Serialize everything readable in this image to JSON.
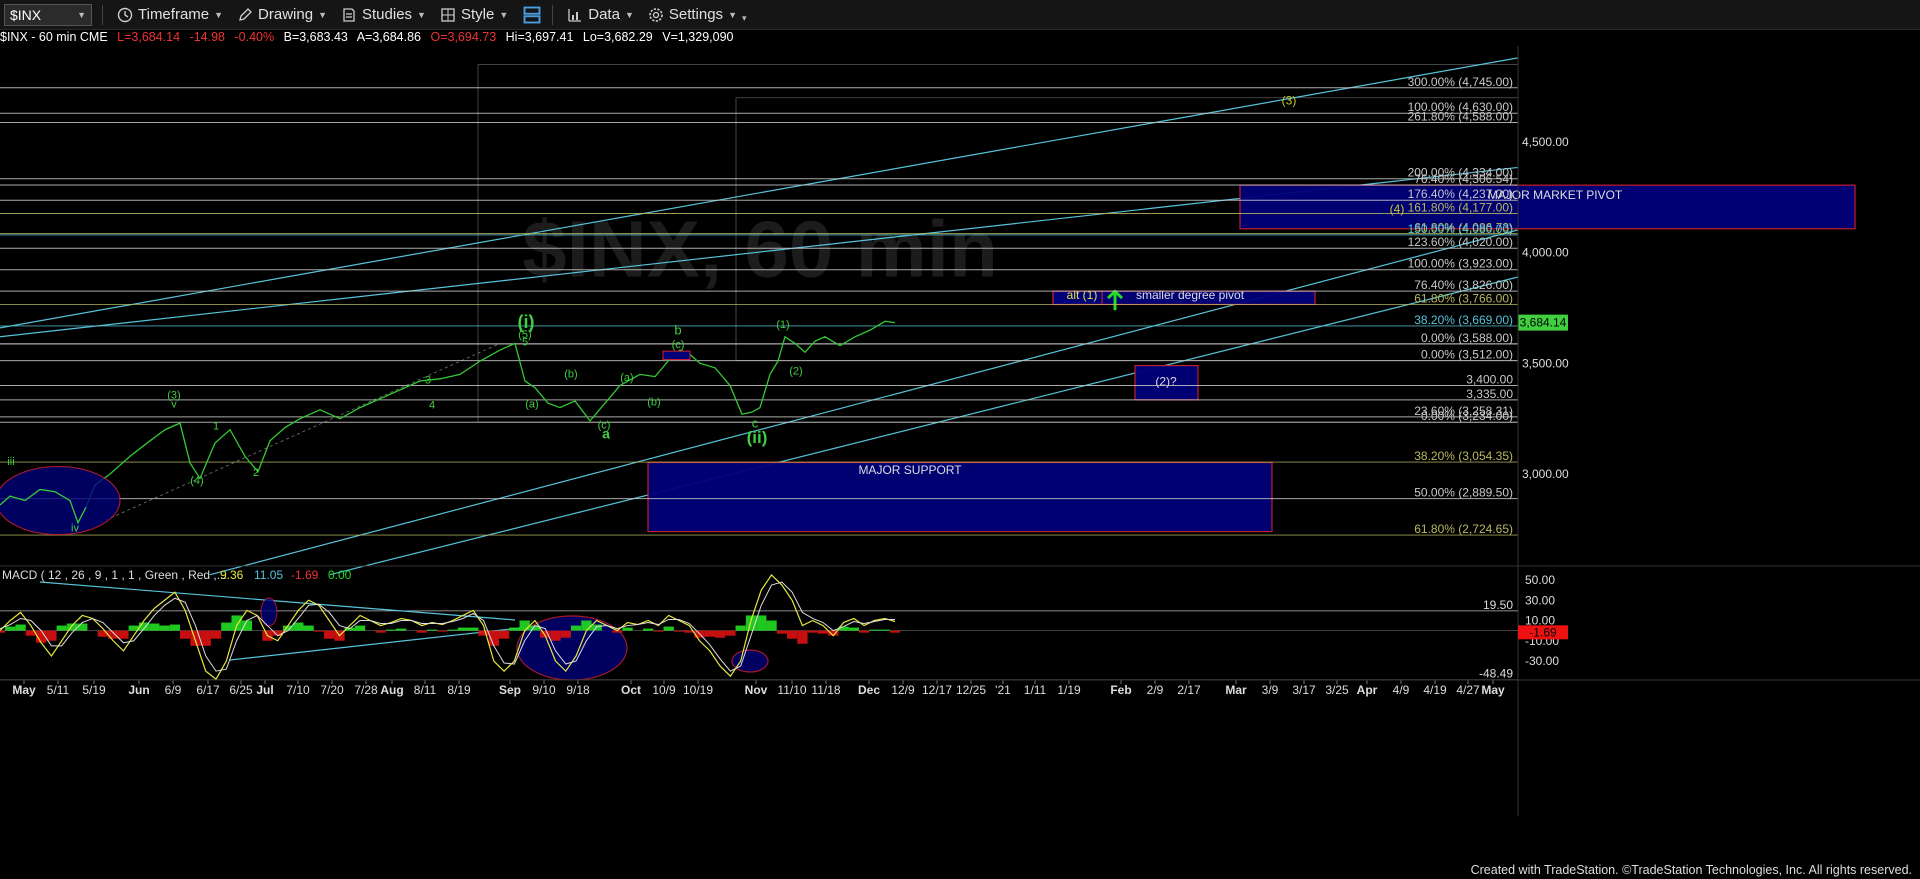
{
  "toolbar": {
    "symbol": "$INX",
    "items": [
      {
        "label": "Timeframe",
        "icon": "clock-icon"
      },
      {
        "label": "Drawing",
        "icon": "pencil-icon"
      },
      {
        "label": "Studies",
        "icon": "studies-icon"
      },
      {
        "label": "Style",
        "icon": "style-icon"
      },
      {
        "label": "",
        "icon": "layout-icon"
      },
      {
        "label": "Data",
        "icon": "data-icon"
      },
      {
        "label": "Settings",
        "icon": "gear-icon"
      }
    ]
  },
  "infobar": {
    "title": "$INX - 60 min  CME",
    "L": "L=3,684.14",
    "chg": "-14.98",
    "pct": "-0.40%",
    "B": "B=3,683.43",
    "A": "A=3,684.86",
    "O": "O=3,694.73",
    "Hi": "Hi=3,697.41",
    "Lo": "Lo=3,682.29",
    "V": "V=1,329,090"
  },
  "colors": {
    "price": "#35c935",
    "wave": "#3fcf3f",
    "fib_white": "#c8c8c8",
    "fib_cyan": "#57c3d9",
    "fib_olive": "#b8b860",
    "box_fill": "#00007a",
    "box_border": "#cc2233",
    "macd_pos": "#22dd22",
    "macd_neg": "#dd1111",
    "current": "#3fcf3f"
  },
  "chart_data": {
    "type": "line",
    "title": "$INX - 60 min",
    "watermark": "$INX, 60 min",
    "ylim": [
      2500,
      4900
    ],
    "y_ticks": [
      3000,
      3500,
      4000,
      4500
    ],
    "y_tick_labels": [
      "3,000.00",
      "3,500.00",
      "4,000.00",
      "4,500.00"
    ],
    "x_ticks": [
      "May",
      "5/11",
      "5/19",
      "Jun",
      "6/9",
      "6/17",
      "6/25",
      "Jul",
      "7/10",
      "7/20",
      "7/28",
      "Aug",
      "8/11",
      "8/19",
      "Sep",
      "9/10",
      "9/18",
      "Oct",
      "10/9",
      "10/19",
      "Nov",
      "11/10",
      "11/18",
      "Dec",
      "12/9",
      "12/17",
      "12/25",
      "'21",
      "1/11",
      "1/19",
      "Feb",
      "2/9",
      "2/17",
      "Mar",
      "3/9",
      "3/17",
      "3/25",
      "Apr",
      "4/9",
      "4/19",
      "4/27",
      "May"
    ],
    "price_series": {
      "name": "$INX",
      "x": [
        0,
        10,
        25,
        40,
        55,
        70,
        78,
        86,
        95,
        110,
        130,
        150,
        165,
        180,
        190,
        200,
        215,
        230,
        245,
        258,
        270,
        285,
        300,
        320,
        340,
        360,
        380,
        400,
        420,
        440,
        460,
        480,
        500,
        515,
        525,
        535,
        548,
        560,
        575,
        590,
        605,
        620,
        640,
        655,
        670,
        680,
        690,
        700,
        715,
        730,
        742,
        752,
        760,
        770,
        778,
        785,
        795,
        805,
        815,
        825,
        840,
        855,
        870,
        885,
        895
      ],
      "values": [
        2860,
        2900,
        2880,
        2930,
        2920,
        2880,
        2780,
        2850,
        2950,
        3000,
        3080,
        3150,
        3200,
        3230,
        3050,
        2980,
        3140,
        3200,
        3080,
        3010,
        3150,
        3210,
        3250,
        3290,
        3250,
        3300,
        3340,
        3380,
        3420,
        3430,
        3450,
        3510,
        3560,
        3590,
        3420,
        3390,
        3320,
        3300,
        3330,
        3240,
        3320,
        3400,
        3450,
        3440,
        3520,
        3560,
        3540,
        3500,
        3480,
        3400,
        3270,
        3280,
        3300,
        3450,
        3510,
        3620,
        3590,
        3550,
        3600,
        3620,
        3580,
        3620,
        3650,
        3690,
        3684
      ]
    },
    "current_price": "3,684.14",
    "fib_levels": [
      {
        "label": "300.00% (4,745.00)",
        "value": 4745,
        "color": "white"
      },
      {
        "label": "100.00% (4,630.00)",
        "value": 4630,
        "color": "white"
      },
      {
        "label": "261.80% (4,588.00)",
        "value": 4588,
        "color": "white"
      },
      {
        "label": "200.00% (4,334.00)",
        "value": 4334,
        "color": "white"
      },
      {
        "label": "76.40% (4,306.54)",
        "value": 4306,
        "color": "white"
      },
      {
        "label": "176.40% (4,237.00)",
        "value": 4237,
        "color": "white"
      },
      {
        "label": "161.80% (4,177.00)",
        "value": 4177,
        "color": "olive"
      },
      {
        "label": "61.80% (4,086.73)",
        "value": 4086,
        "color": "olive"
      },
      {
        "label": "150.00% (4,080.00)",
        "value": 4080,
        "color": "cyan"
      },
      {
        "label": "123.60% (4,020.00)",
        "value": 4020,
        "color": "white"
      },
      {
        "label": "100.00% (3,923.00)",
        "value": 3923,
        "color": "white"
      },
      {
        "label": "76.40% (3,826.00)",
        "value": 3826,
        "color": "white"
      },
      {
        "label": "61.80% (3,766.00)",
        "value": 3766,
        "color": "olive"
      },
      {
        "label": "38.20% (3,669.00)",
        "value": 3669,
        "color": "cyan"
      },
      {
        "label": "0.00% (3,588.00)",
        "value": 3588,
        "color": "white"
      },
      {
        "label": "0.00% (3,512.00)",
        "value": 3512,
        "color": "white"
      },
      {
        "label": "3,400.00",
        "value": 3400,
        "color": "white"
      },
      {
        "label": "3,335.00",
        "value": 3335,
        "color": "white"
      },
      {
        "label": "23.60% (3,258.31)",
        "value": 3258,
        "color": "white"
      },
      {
        "label": "0.00% (3,234.00)",
        "value": 3234,
        "color": "white"
      },
      {
        "label": "38.20% (3,054.35)",
        "value": 3054,
        "color": "olive"
      },
      {
        "label": "50.00% (2,889.50)",
        "value": 2889,
        "color": "white"
      },
      {
        "label": "61.80% (2,724.65)",
        "value": 2724,
        "color": "olive"
      }
    ],
    "zones": [
      {
        "label": "MAJOR MARKET PIVOT",
        "x0": 1240,
        "x1": 1855,
        "y0": 4108,
        "y1": 4305
      },
      {
        "label": "MAJOR SUPPORT",
        "x0": 648,
        "x1": 1272,
        "y0": 2740,
        "y1": 3052
      },
      {
        "label": "smaller degree pivot",
        "x0": 1053,
        "x1": 1315,
        "y0": 3766,
        "y1": 3826
      },
      {
        "label": "alt (1)",
        "x0": 1053,
        "x1": 1102,
        "y0": 3766,
        "y1": 3826
      },
      {
        "label": "(2)?",
        "x0": 1135,
        "x1": 1198,
        "y0": 3335,
        "y1": 3490
      }
    ],
    "wave_labels": [
      "(i)",
      "(5)",
      "5",
      "b",
      "(c)",
      "(a)",
      "(b)",
      "(c)",
      "a",
      "(a)",
      "(b)",
      "c",
      "(ii)",
      "(1)",
      "(2)",
      "(3)",
      "(4)",
      "(3)",
      "v",
      "1",
      "(4)",
      "2",
      "3",
      "4",
      "iii",
      "iv"
    ],
    "macd": {
      "title": "MACD ( 12 , 26 , 9 , 1 , 1 , Green , Red ,...",
      "values": [
        "9.36",
        "11.05",
        "-1.69",
        "0.00"
      ],
      "ylim": [
        -60,
        60
      ],
      "y_ticks": [
        50,
        30,
        10,
        -10,
        -30
      ],
      "y_tick_labels": [
        "50.00",
        "30.00",
        "10.00",
        "-10.00",
        "-30.00"
      ],
      "levels": [
        {
          "label": "19.50",
          "value": 19.5
        },
        {
          "label": "-48.49",
          "value": -48.5
        }
      ],
      "current": "-1.69",
      "series": [
        {
          "name": "MACD",
          "values": [
            0,
            10,
            18,
            5,
            -12,
            -25,
            -10,
            5,
            15,
            12,
            2,
            -10,
            -20,
            -5,
            10,
            22,
            30,
            38,
            20,
            -10,
            -40,
            -48,
            -30,
            5,
            20,
            15,
            -5,
            -10,
            5,
            20,
            30,
            25,
            10,
            -5,
            5,
            15,
            10,
            5,
            8,
            12,
            10,
            5,
            8,
            6,
            10,
            15,
            20,
            5,
            -30,
            -40,
            -30,
            0,
            10,
            -5,
            -30,
            -40,
            -25,
            0,
            10,
            5,
            0,
            8,
            6,
            10,
            5,
            15,
            10,
            5,
            -10,
            -20,
            -35,
            -45,
            -30,
            10,
            40,
            55,
            45,
            30,
            5,
            10,
            5,
            -5,
            8,
            12,
            5,
            10,
            12,
            9
          ]
        },
        {
          "name": "Signal",
          "values": [
            2,
            6,
            12,
            10,
            0,
            -15,
            -15,
            -2,
            8,
            12,
            8,
            -2,
            -12,
            -10,
            2,
            15,
            25,
            32,
            28,
            5,
            -25,
            -40,
            -38,
            -10,
            10,
            15,
            5,
            -5,
            0,
            12,
            25,
            26,
            18,
            5,
            2,
            10,
            10,
            7,
            7,
            10,
            10,
            7,
            7,
            7,
            9,
            12,
            17,
            10,
            -15,
            -32,
            -33,
            -10,
            5,
            2,
            -20,
            -33,
            -30,
            -10,
            4,
            5,
            2,
            5,
            6,
            8,
            6,
            11,
            11,
            7,
            -3,
            -14,
            -28,
            -40,
            -35,
            -5,
            25,
            45,
            48,
            38,
            18,
            12,
            8,
            0,
            4,
            9,
            7,
            9,
            11,
            11
          ]
        }
      ]
    }
  },
  "footer": "Created with TradeStation. ©TradeStation Technologies, Inc. All rights reserved."
}
